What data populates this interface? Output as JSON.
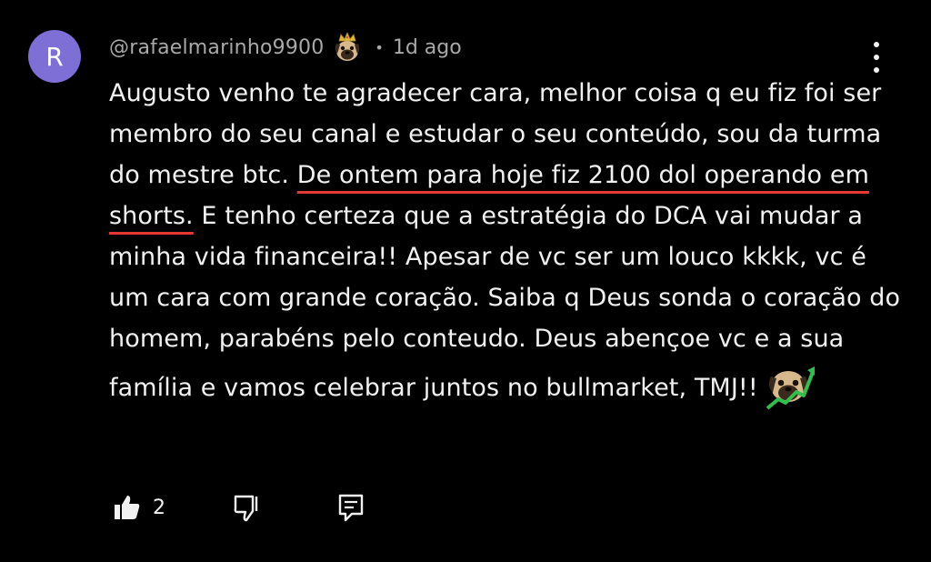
{
  "comment": {
    "avatar_letter": "R",
    "avatar_color": "#7e6fd6",
    "handle": "@rafaelmarinho9900",
    "badge_icon": "pug-king-icon",
    "separator": "•",
    "time": "1d ago",
    "text": {
      "part1": "Augusto venho te agradecer cara, melhor coisa q eu fiz foi ser membro do seu canal e estudar o seu conteúdo, sou da turma do mestre btc. ",
      "highlight": "De ontem para hoje fiz 2100 dol operando em shorts.",
      "part2": " E tenho certeza que a estratégia do DCA vai mudar a minha vida financeira!! Apesar de vc ser um louco kkkk, vc é um cara com grande coração. Saiba q Deus sonda o coração do homem, parabéns pelo conteudo. Deus abençoe vc e a sua família e vamos celebrar juntos no bullmarket, TMJ!!",
      "emoji_icon": "pug-chart-up-icon"
    },
    "highlight_color": "#e53935",
    "actions": {
      "like_count": "2",
      "like_icon": "thumbs-up-icon",
      "dislike_icon": "thumbs-down-icon",
      "reply_icon": "reply-comment-icon"
    },
    "menu_icon": "more-vertical-icon"
  }
}
